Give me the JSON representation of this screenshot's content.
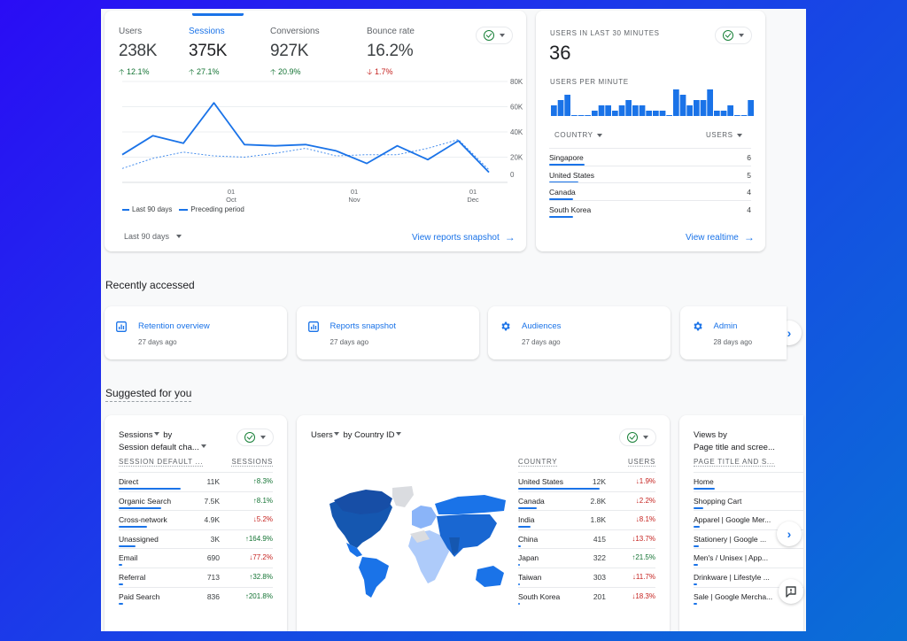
{
  "overview": {
    "metrics": [
      {
        "label": "Users",
        "value": "238K",
        "change": "12.1%",
        "direction": "up"
      },
      {
        "label": "Sessions",
        "value": "375K",
        "change": "27.1%",
        "direction": "up",
        "active": true
      },
      {
        "label": "Conversions",
        "value": "927K",
        "change": "20.9%",
        "direction": "up"
      },
      {
        "label": "Bounce rate",
        "value": "16.2%",
        "change": "1.7%",
        "direction": "down"
      }
    ],
    "date_range": "Last 90 days",
    "view_link": "View reports snapshot"
  },
  "chart_data": {
    "type": "line",
    "title": "Sessions",
    "x_tick_labels": [
      {
        "day": "01",
        "month": "Oct"
      },
      {
        "day": "01",
        "month": "Nov"
      },
      {
        "day": "01",
        "month": "Dec"
      }
    ],
    "y_tick_labels": [
      "80K",
      "60K",
      "40K",
      "20K",
      "0"
    ],
    "ylim": [
      0,
      80000
    ],
    "grid": true,
    "legend": [
      "Last 90 days",
      "Preceding period"
    ],
    "legend_position": "bottom-left",
    "series": [
      {
        "name": "Last 90 days",
        "style": "solid",
        "values": [
          22000,
          37000,
          31000,
          63000,
          30000,
          29000,
          30000,
          25000,
          15000,
          29000,
          18000,
          33000,
          8000
        ]
      },
      {
        "name": "Preceding period",
        "style": "dashed",
        "values": [
          11000,
          19000,
          24000,
          21000,
          20000,
          23000,
          27000,
          21000,
          22000,
          22000,
          27000,
          34000,
          10000
        ]
      }
    ]
  },
  "realtime": {
    "title": "USERS IN LAST 30 MINUTES",
    "value": "36",
    "per_minute_label": "USERS PER MINUTE",
    "per_minute": [
      2,
      3,
      4,
      0,
      0,
      0,
      1,
      2,
      2,
      1,
      2,
      3,
      2,
      2,
      1,
      1,
      1,
      0,
      5,
      4,
      2,
      3,
      3,
      5,
      1,
      1,
      2,
      0,
      0,
      3
    ],
    "columns": {
      "country": "COUNTRY",
      "users": "USERS"
    },
    "rows": [
      {
        "country": "Singapore",
        "users": "6",
        "share": 1.0
      },
      {
        "country": "United States",
        "users": "5",
        "share": 0.83
      },
      {
        "country": "Canada",
        "users": "4",
        "share": 0.67
      },
      {
        "country": "South Korea",
        "users": "4",
        "share": 0.67
      }
    ],
    "view_link": "View realtime"
  },
  "recently_accessed": {
    "title": "Recently accessed",
    "items": [
      {
        "icon": "report-icon",
        "title": "Retention overview",
        "time": "27 days ago"
      },
      {
        "icon": "report-icon",
        "title": "Reports snapshot",
        "time": "27 days ago"
      },
      {
        "icon": "gear-icon",
        "title": "Audiences",
        "time": "27 days ago"
      },
      {
        "icon": "gear-icon",
        "title": "Admin",
        "time": "28 days ago"
      }
    ]
  },
  "suggested": {
    "title": "Suggested for you",
    "sessions_card": {
      "title_line1": "Sessions",
      "title_by": "by",
      "title_line2": "Session default cha...",
      "col1": "SESSION DEFAULT ...",
      "col2": "SESSIONS",
      "rows": [
        {
          "name": "Direct",
          "value": "11K",
          "change": "8.3%",
          "direction": "up",
          "share": 1.0
        },
        {
          "name": "Organic Search",
          "value": "7.5K",
          "change": "8.1%",
          "direction": "up",
          "share": 0.68
        },
        {
          "name": "Cross-network",
          "value": "4.9K",
          "change": "5.2%",
          "direction": "down",
          "share": 0.45
        },
        {
          "name": "Unassigned",
          "value": "3K",
          "change": "164.9%",
          "direction": "up",
          "share": 0.27
        },
        {
          "name": "Email",
          "value": "690",
          "change": "77.2%",
          "direction": "down",
          "share": 0.063
        },
        {
          "name": "Referral",
          "value": "713",
          "change": "32.8%",
          "direction": "up",
          "share": 0.065
        },
        {
          "name": "Paid Search",
          "value": "836",
          "change": "201.8%",
          "direction": "up",
          "share": 0.076
        }
      ]
    },
    "country_card": {
      "title_metric": "Users",
      "title_by": "by",
      "title_dim": "Country ID",
      "col1": "COUNTRY",
      "col2": "USERS",
      "rows": [
        {
          "name": "United States",
          "value": "12K",
          "change": "1.9%",
          "direction": "down",
          "share": 1.0
        },
        {
          "name": "Canada",
          "value": "2.8K",
          "change": "2.2%",
          "direction": "down",
          "share": 0.23
        },
        {
          "name": "India",
          "value": "1.8K",
          "change": "8.1%",
          "direction": "down",
          "share": 0.15
        },
        {
          "name": "China",
          "value": "415",
          "change": "13.7%",
          "direction": "down",
          "share": 0.035
        },
        {
          "name": "Japan",
          "value": "322",
          "change": "21.5%",
          "direction": "up",
          "share": 0.027
        },
        {
          "name": "Taiwan",
          "value": "303",
          "change": "11.7%",
          "direction": "down",
          "share": 0.025
        },
        {
          "name": "South Korea",
          "value": "201",
          "change": "18.3%",
          "direction": "down",
          "share": 0.017
        }
      ]
    },
    "views_card": {
      "title_line1": "Views by",
      "title_line2": "Page title and scree...",
      "col1": "PAGE TITLE AND S...",
      "rows": [
        {
          "name": "Home",
          "share": 1.0
        },
        {
          "name": "Shopping Cart",
          "share": 0.45
        },
        {
          "name": "Apparel | Google Mer...",
          "share": 0.3
        },
        {
          "name": "Stationery | Google ...",
          "share": 0.25
        },
        {
          "name": "Men's / Unisex | App...",
          "share": 0.2
        },
        {
          "name": "Drinkware | Lifestyle ...",
          "share": 0.18
        },
        {
          "name": "Sale | Google Mercha...",
          "share": 0.15
        }
      ]
    }
  },
  "colors": {
    "accent": "#1a73e8",
    "up": "#137333",
    "down": "#c5221f"
  }
}
